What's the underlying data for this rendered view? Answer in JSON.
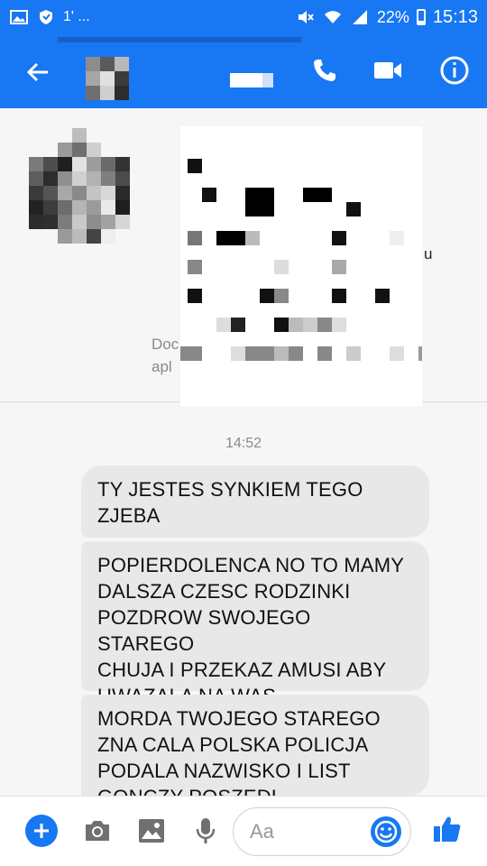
{
  "status_bar": {
    "left_text": "1' ...",
    "battery": "22%",
    "time": "15:13",
    "icons": [
      "gallery-icon",
      "shield-icon",
      "mute-icon",
      "wifi-icon",
      "signal-icon",
      "battery-icon"
    ]
  },
  "header": {
    "back_icon": "arrow-left-icon",
    "call_icon": "phone-icon",
    "video_icon": "video-camera-icon",
    "info_icon": "info-icon"
  },
  "profile": {
    "partial_text_1": "Doc",
    "partial_text_2": "apl",
    "partial_text_3": "u"
  },
  "thread": {
    "timestamp": "14:52",
    "messages": [
      {
        "text": "TY JESTES SYNKIEM TEGO\nZJEBA"
      },
      {
        "text": "POPIERDOLENCA NO TO MAMY\nDALSZA CZESC RODZINKI\nPOZDROW SWOJEGO STAREGO\nCHUJA I PRZEKAZ AMUSI ABY\nUWAZALA NA WAS"
      },
      {
        "text": "MORDA TWOJEGO STAREGO\nZNA CALA POLSKA POLICJA\nPODALA NAZWISKO I LIST\nGONCZY POSZEDL"
      }
    ]
  },
  "composer": {
    "placeholder": "Aa",
    "icons": [
      "plus-icon",
      "camera-icon",
      "image-icon",
      "microphone-icon",
      "emoji-icon",
      "thumbs-up-icon"
    ]
  },
  "colors": {
    "brand": "#1877f2",
    "bubble": "#e8e8e8"
  }
}
